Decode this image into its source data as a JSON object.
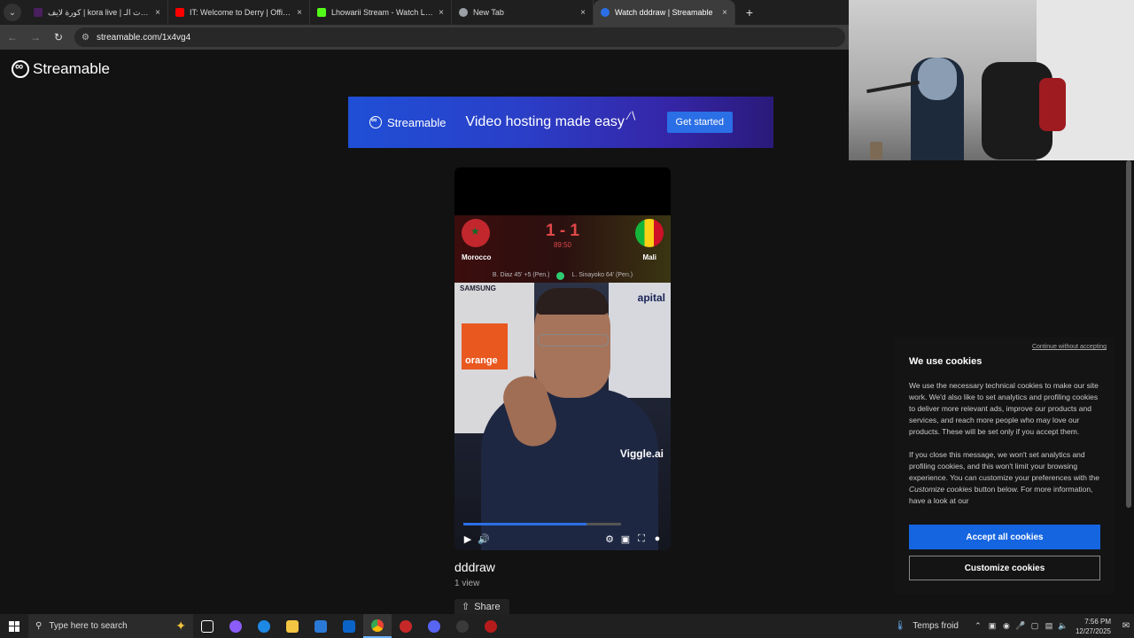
{
  "browser": {
    "tabs": [
      {
        "title": "كورة لايف | kora live | مباريات الـ",
        "favicon_color": "#4a1f5e",
        "active": false
      },
      {
        "title": "IT: Welcome to Derry | Official T",
        "favicon_color": "#ff0000",
        "active": false
      },
      {
        "title": "Lhowarii Stream - Watch Live on",
        "favicon_color": "#53fc18",
        "active": false
      },
      {
        "title": "New Tab",
        "favicon_color": "#9aa0a6",
        "active": false
      },
      {
        "title": "Watch dddraw | Streamable",
        "favicon_color": "#2b6fe6",
        "active": true
      }
    ],
    "tab_close_icon": "×",
    "new_tab_icon": "+",
    "tab_menu_icon": "⌄",
    "address": "streamable.com/1x4vg4"
  },
  "site": {
    "logo_text": "Streamable",
    "banner": {
      "brand": "Streamable",
      "tagline": "Video hosting made easy",
      "cta": "Get started"
    }
  },
  "match": {
    "home_team": "Morocco",
    "away_team": "Mali",
    "score": "1 - 1",
    "clock": "89:50",
    "home_scorer": "B. Diaz 45' +5 (Pen.)",
    "away_scorer": "L. Sinayoko 64' (Pen.)"
  },
  "video_overlay": {
    "sponsor_left": "SAMSUNG",
    "orange_logo": "orange",
    "sponsor_right": "apital",
    "watermark": "Viggle.ai",
    "progress": 0.78
  },
  "video": {
    "title": "dddraw",
    "views": "1 view",
    "share_label": "Share"
  },
  "cookie": {
    "continue_link": "Continue without accepting",
    "title": "We use cookies",
    "paragraph1": "We use the necessary technical cookies to make our site work. We'd also like to set analytics and profiling cookies to deliver more relevant ads, improve our products and services, and reach more people who may love our products. These will be set only if you accept them.",
    "paragraph2_before": "If you close this message, we won't set analytics and profiling cookies, and this won't limit your browsing experience. You can customize your preferences with the ",
    "paragraph2_em": "Customize cookies",
    "paragraph2_after": " button below. For more information, have a look at our",
    "accept_label": "Accept all cookies",
    "customize_label": "Customize cookies"
  },
  "taskbar": {
    "search_placeholder": "Type here to search",
    "weather": "Temps froid",
    "time": "7:56 PM",
    "date": "12/27/2025",
    "apps": [
      {
        "name": "task-view",
        "color": "#ffffff"
      },
      {
        "name": "copilot",
        "color": "#8b5cf6"
      },
      {
        "name": "edge",
        "color": "#1e88e5"
      },
      {
        "name": "file-explorer",
        "color": "#f4c542"
      },
      {
        "name": "store",
        "color": "#2b79d6"
      },
      {
        "name": "outlook",
        "color": "#0a64c8"
      },
      {
        "name": "chrome",
        "color": "#34a853"
      },
      {
        "name": "app-red",
        "color": "#c62828"
      },
      {
        "name": "discord",
        "color": "#5865f2"
      },
      {
        "name": "app-k",
        "color": "#3a3a3a"
      },
      {
        "name": "app-dark",
        "color": "#b71c1c"
      }
    ]
  }
}
